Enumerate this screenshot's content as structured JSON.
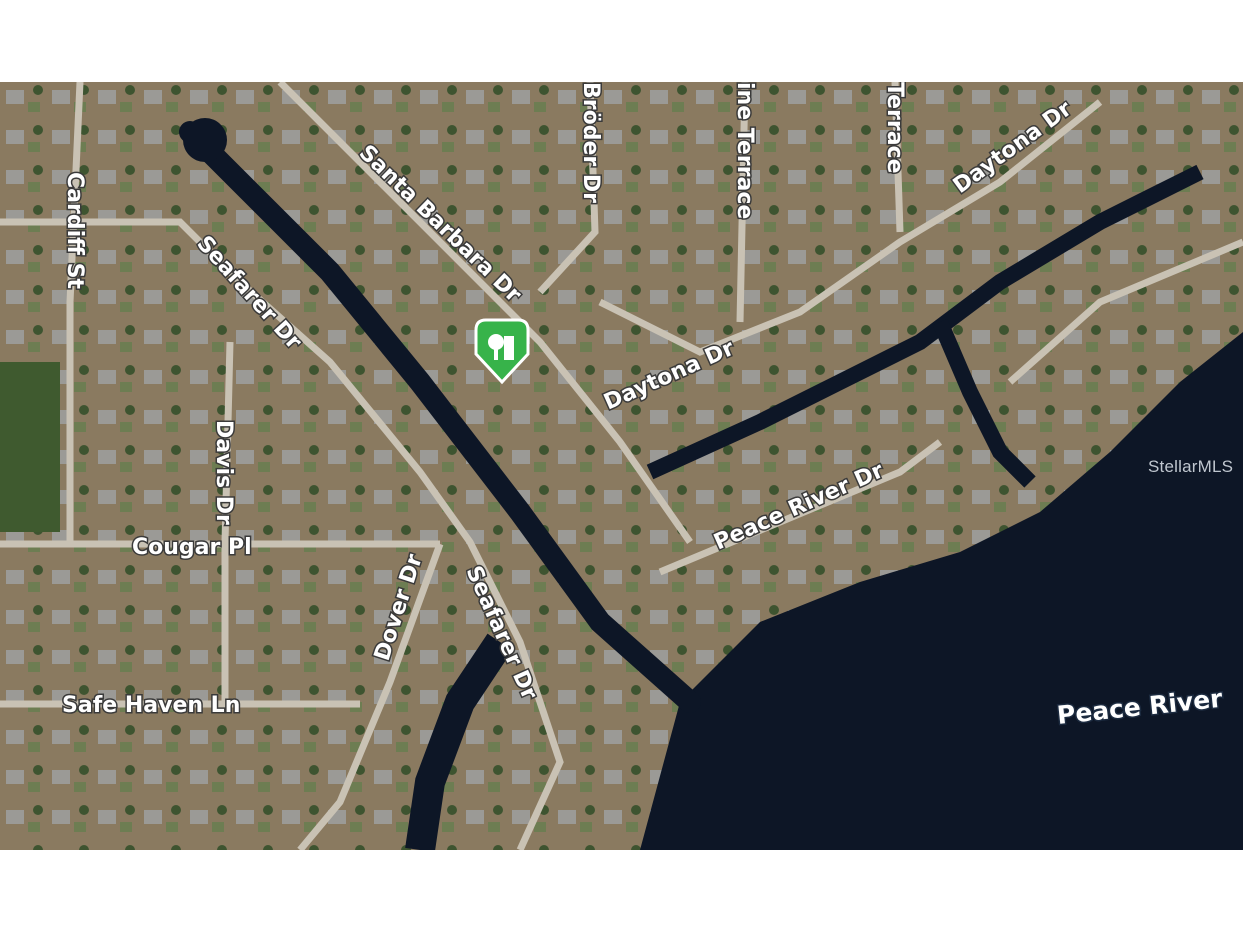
{
  "map": {
    "type": "satellite",
    "colors": {
      "land": "#8f7d62",
      "water": "#0d1626",
      "road": "#c9c2b4",
      "vegetation": "#3f5a2f",
      "marker": "#37b34a"
    },
    "marker": {
      "icon": "property-pin-icon"
    },
    "streets": {
      "santa_barbara": "Santa Barbara Dr",
      "broder": "Bröder Dr",
      "pine_terrace": "ine Terrace",
      "terrace": "Terrace",
      "daytona_top": "Daytona Dr",
      "daytona_mid": "Daytona Dr",
      "cardiff": "Cardiff St",
      "seafarer_top": "Seafarer Dr",
      "davis": "Davis Dr",
      "cougar": "Cougar Pl",
      "dover": "Dover Dr",
      "seafarer_bottom": "Seafarer Dr",
      "peace_river_dr": "Peace River Dr",
      "safe_haven": "Safe Haven Ln"
    },
    "water_label": "Peace River",
    "watermark": "StellarMLS"
  }
}
